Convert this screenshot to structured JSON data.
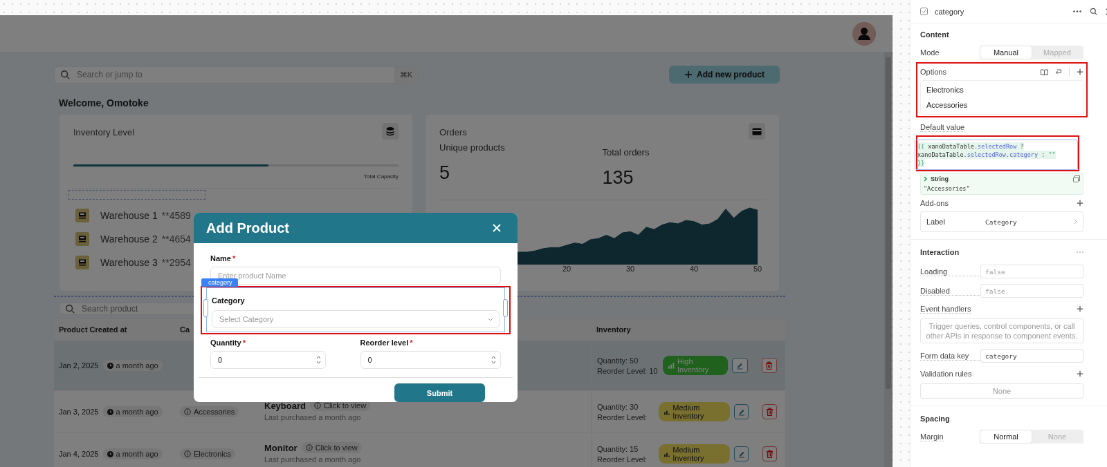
{
  "app": {
    "search": {
      "placeholder": "Search or jump to",
      "shortcut": "⌘K"
    },
    "add_button": "Add new product",
    "welcome": "Welcome, Omotoke",
    "inventory_card": {
      "title": "Inventory Level",
      "level": 0.6,
      "capacity_label": "Total Capacity",
      "warehouses": [
        {
          "name": "Warehouse 1",
          "code": "**4589"
        },
        {
          "name": "Warehouse 2",
          "code": "**4654"
        },
        {
          "name": "Warehouse 3",
          "code": "**2954"
        }
      ]
    },
    "orders_card": {
      "title": "Orders",
      "stats": [
        {
          "label": "Unique products",
          "value": "5"
        },
        {
          "label": "Total orders",
          "value": "135"
        }
      ],
      "x_ticks": [
        "20",
        "30",
        "40",
        "50"
      ]
    },
    "product_search": {
      "placeholder": "Search product"
    },
    "table": {
      "columns": [
        "Product Created at",
        "Ca",
        "Inventory"
      ],
      "rows": [
        {
          "selected": true,
          "date": "Jan 2, 2025",
          "ago": "a month ago",
          "quantity": "Quantity: 50",
          "reorder": "Reorder Level: 10",
          "stock": {
            "kind": "high",
            "label": "High Inventory"
          }
        },
        {
          "selected": false,
          "date": "Jan 3, 2025",
          "ago": "a month ago",
          "category": "Accessories",
          "product": "Keyboard",
          "view": "Click to view",
          "purchased": "Last purchased a month ago",
          "quantity": "Quantity: 30",
          "reorder": "Reorder Level:",
          "stock": {
            "kind": "medium",
            "label": "Medium Inventory"
          }
        },
        {
          "selected": false,
          "date": "Jan 4, 2025",
          "ago": "a month ago",
          "category": "Electronics",
          "product": "Monitor",
          "view": "Click to view",
          "purchased": "Last purchased a month ago",
          "quantity": "Quantity: 15",
          "reorder": "Reorder Level:",
          "stock": {
            "kind": "medium",
            "label": "Medium Inventory"
          }
        }
      ]
    }
  },
  "modal": {
    "title": "Add Product",
    "required_mark": "*",
    "name_field": {
      "label": "Name",
      "required": true,
      "placeholder": "Enter product Name"
    },
    "category_field": {
      "tag": "category",
      "label": "Category",
      "required": false,
      "placeholder": "Select Category"
    },
    "number_fields": [
      {
        "label": "Quantity",
        "required": true,
        "value": "0"
      },
      {
        "label": "Reorder level",
        "required": true,
        "value": "0"
      }
    ],
    "submit": "Submit"
  },
  "panel": {
    "title": "category",
    "content": {
      "heading": "Content",
      "mode": {
        "label": "Mode",
        "options": [
          {
            "label": "Manual",
            "selected": true
          },
          {
            "label": "Mapped",
            "selected": false
          }
        ]
      },
      "options": {
        "label": "Options",
        "items": [
          "Electronics",
          "Accessories"
        ]
      },
      "default_value": {
        "label": "Default value",
        "code": [
          [
            {
              "text": "{{",
              "kind": "brace"
            },
            {
              "text": " xanoDataTable",
              "kind": "name"
            },
            {
              "text": ".",
              "kind": "plain"
            },
            {
              "text": "selectedRow",
              "kind": "prop"
            },
            {
              "text": " ?",
              "kind": "plain"
            }
          ],
          [
            {
              "text": "xanoDataTable",
              "kind": "name"
            },
            {
              "text": ".",
              "kind": "plain"
            },
            {
              "text": "selectedRow",
              "kind": "prop"
            },
            {
              "text": ".",
              "kind": "plain"
            },
            {
              "text": "category",
              "kind": "prop"
            },
            {
              "text": " : ",
              "kind": "plain"
            },
            {
              "text": "\"\"",
              "kind": "string"
            }
          ],
          [
            {
              "text": "}}",
              "kind": "brace"
            }
          ]
        ],
        "result_type": "String",
        "result": "\"Accessories\""
      },
      "addons": {
        "label": "Add-ons",
        "rows": [
          {
            "label": "Label",
            "value": "Category"
          }
        ]
      }
    },
    "interaction": {
      "heading": "Interaction",
      "fields": [
        {
          "label": "Loading",
          "placeholder": "false"
        },
        {
          "label": "Disabled",
          "placeholder": "false"
        }
      ],
      "event_handlers": {
        "label": "Event handlers",
        "hint": "Trigger queries, control components, or call other APIs in response to component events."
      },
      "form_key": {
        "label": "Form data key",
        "value": "category"
      },
      "validation": {
        "label": "Validation rules",
        "value": "None"
      }
    },
    "spacing": {
      "heading": "Spacing",
      "margin": {
        "label": "Margin",
        "options": [
          {
            "label": "Normal",
            "selected": true
          },
          {
            "label": "None",
            "selected": false
          }
        ]
      }
    }
  }
}
